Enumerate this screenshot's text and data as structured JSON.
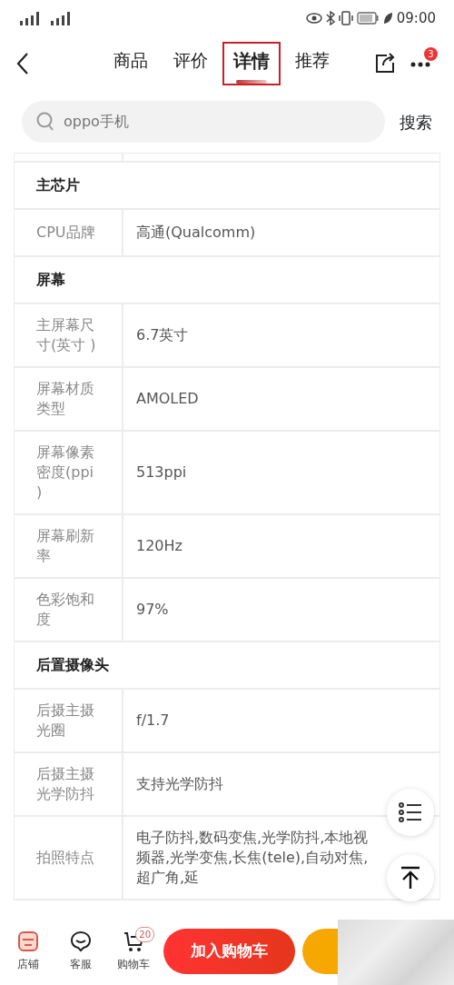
{
  "status_bar": {
    "time": "09:00"
  },
  "header": {
    "tabs": [
      {
        "label": "商品",
        "selected": false
      },
      {
        "label": "评价",
        "selected": false
      },
      {
        "label": "详情",
        "selected": true,
        "highlighted": true
      },
      {
        "label": "推荐",
        "selected": false
      }
    ],
    "more_badge": "3"
  },
  "search": {
    "placeholder": "oppo手机",
    "button": "搜索"
  },
  "specs": [
    {
      "kind": "section",
      "title": "主芯片"
    },
    {
      "kind": "row",
      "label": "CPU品牌",
      "value": "高通(Qualcomm)"
    },
    {
      "kind": "section",
      "title": "屏幕"
    },
    {
      "kind": "row",
      "label": "主屏幕尺寸(英寸 )",
      "value": "6.7英寸"
    },
    {
      "kind": "row",
      "label": "屏幕材质类型",
      "value": "AMOLED"
    },
    {
      "kind": "row",
      "label": "屏幕像素密度(ppi )",
      "value": "513ppi"
    },
    {
      "kind": "row",
      "label": "屏幕刷新率",
      "value": "120Hz"
    },
    {
      "kind": "row",
      "label": "色彩饱和度",
      "value": "97%"
    },
    {
      "kind": "section",
      "title": "后置摄像头"
    },
    {
      "kind": "row",
      "label": "后摄主摄光圈",
      "value": "f/1.7"
    },
    {
      "kind": "row",
      "label": "后摄主摄光学防抖",
      "value": "支持光学防抖"
    },
    {
      "kind": "row",
      "label": "拍照特点",
      "value": "电子防抖,数码变焦,光学防抖,本地视频器,光学变焦,长焦(tele),自动对焦,超广角,延"
    }
  ],
  "bottom_bar": {
    "items": [
      {
        "label": "店铺",
        "kind": "store"
      },
      {
        "label": "客服",
        "kind": "service"
      },
      {
        "label": "购物车",
        "kind": "cart",
        "badge": "20"
      }
    ],
    "add_to_cart": "加入购物车"
  }
}
